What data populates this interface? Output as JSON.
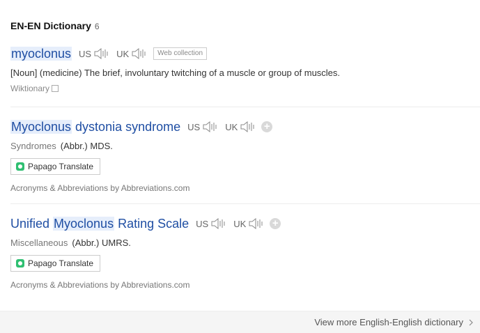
{
  "header": {
    "title": "EN-EN Dictionary",
    "count": "6"
  },
  "pron": {
    "us": "US",
    "uk": "UK"
  },
  "entries": [
    {
      "word_parts": [
        "myoclonus"
      ],
      "web_collection": "Web collection",
      "definition": "[Noun] (medicine) The brief, involuntary twitching of a muscle or group of muscles.",
      "source": "Wiktionary"
    },
    {
      "word_parts": [
        "Myoclonus",
        " dystonia syndrome"
      ],
      "category": "Syndromes",
      "abbr": "(Abbr.) MDS.",
      "papago": "Papago Translate",
      "source": "Acronyms & Abbreviations by Abbreviations.com"
    },
    {
      "word_parts": [
        "Unified ",
        "Myoclonus",
        " Rating Scale"
      ],
      "category": "Miscellaneous",
      "abbr": "(Abbr.) UMRS.",
      "papago": "Papago Translate",
      "source": "Acronyms & Abbreviations by Abbreviations.com"
    }
  ],
  "footer": {
    "view_more": "View more English-English dictionary"
  },
  "colors": {
    "link": "#1f4ea3",
    "highlight": "#e6eefb"
  },
  "icons": {
    "speaker": "speaker-icon",
    "plus": "plus-icon",
    "chevron": "chevron-right-icon",
    "papago": "papago-icon"
  }
}
